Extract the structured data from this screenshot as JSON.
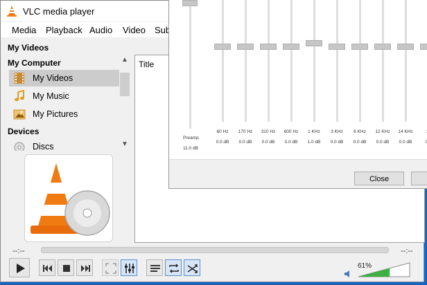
{
  "window": {
    "title": "VLC media player"
  },
  "menu": [
    "Media",
    "Playback",
    "Audio",
    "Video",
    "Sub"
  ],
  "sidebar": {
    "sections": [
      {
        "label": "My Videos"
      },
      {
        "label": "My Computer"
      },
      {
        "label": "Devices"
      }
    ],
    "items": [
      {
        "label": "My Videos",
        "icon": "film-icon",
        "selected": true
      },
      {
        "label": "My Music",
        "icon": "music-note-icon"
      },
      {
        "label": "My Pictures",
        "icon": "picture-icon"
      },
      {
        "label": "Discs",
        "icon": "disc-icon"
      }
    ]
  },
  "playlist": {
    "column_title": "Title"
  },
  "player": {
    "time_elapsed": "--:--",
    "time_total": "--:--",
    "volume": "61%",
    "volume_level": 0.61
  },
  "equalizer": {
    "preamp_label": "Preamp",
    "preamp_value": "11.0 dB",
    "bands": [
      {
        "freq": "60 Hz",
        "value": "0.0 dB"
      },
      {
        "freq": "170 Hz",
        "value": "0.0 dB"
      },
      {
        "freq": "310 Hz",
        "value": "0.0 dB"
      },
      {
        "freq": "600 Hz",
        "value": "0.0 dB"
      },
      {
        "freq": "1 KHz",
        "value": "1.0 dB"
      },
      {
        "freq": "3 KHz",
        "value": "0.0 dB"
      },
      {
        "freq": "6 KHz",
        "value": "0.0 dB"
      },
      {
        "freq": "12 KHz",
        "value": "0.0 dB"
      },
      {
        "freq": "14 KHz",
        "value": "0.0 dB"
      },
      {
        "freq": "16",
        "value": "0.0"
      }
    ],
    "close_label": "Close"
  },
  "colors": {
    "accent": "#1565c0",
    "volume_fill": "#3cb043",
    "selected_bg": "#cccccc"
  }
}
